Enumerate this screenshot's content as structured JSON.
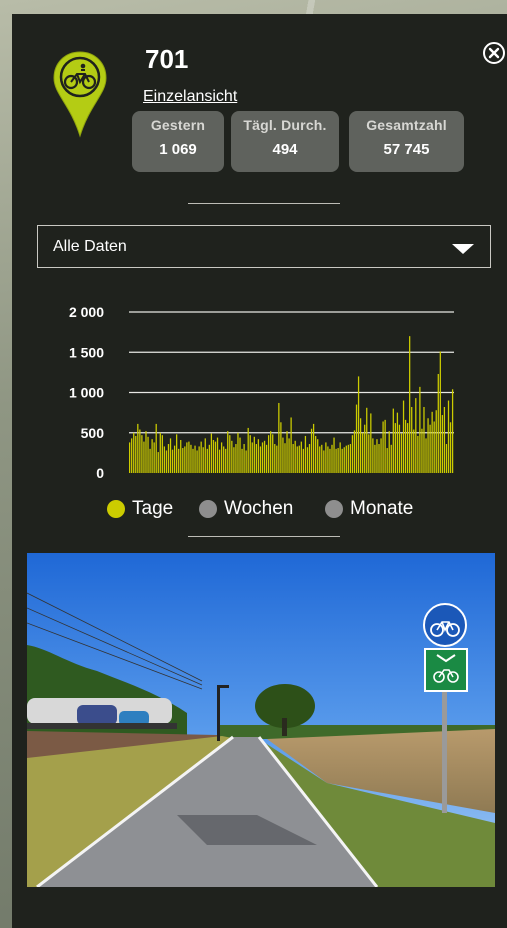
{
  "counter": {
    "id": "701",
    "detail_link": "Einzelansicht"
  },
  "stats": [
    {
      "label": "Gestern",
      "value": "1 069"
    },
    {
      "label": "Tägl. Durch.",
      "value": "494"
    },
    {
      "label": "Gesamtzahl",
      "value": "57 745"
    }
  ],
  "filter": {
    "selected": "Alle Daten"
  },
  "legend": [
    {
      "label": "Tage",
      "color": "#cccc00",
      "active": true
    },
    {
      "label": "Wochen",
      "color": "#8e8e8e",
      "active": false
    },
    {
      "label": "Monate",
      "color": "#8e8e8e",
      "active": false
    }
  ],
  "icons": {
    "pin": "bicycle-map-pin-icon",
    "close": "close-circle-icon",
    "dropdown": "caret-down-icon"
  },
  "colors": {
    "panel_bg": "#1f221d",
    "bar": "#cccc00",
    "pin": "#b4cc14",
    "stat_bg": "#5f625d"
  },
  "chart_data": {
    "type": "bar",
    "ylim": [
      0,
      2000
    ],
    "yticks": [
      0,
      500,
      1000,
      1500,
      2000
    ],
    "ytick_labels": [
      "0",
      "500",
      "1 000",
      "1 500",
      "2 000"
    ],
    "grid": true,
    "series": [
      {
        "values": [
          380,
          430,
          500,
          460,
          610,
          540,
          470,
          390,
          520,
          450,
          300,
          420,
          380,
          610,
          260,
          500,
          470,
          330,
          280,
          360,
          430,
          290,
          340,
          480,
          300,
          410,
          310,
          330,
          380,
          390,
          350,
          300,
          340,
          280,
          330,
          390,
          320,
          430,
          300,
          350,
          490,
          410,
          390,
          440,
          290,
          380,
          330,
          300,
          520,
          470,
          400,
          320,
          360,
          500,
          440,
          300,
          360,
          280,
          560,
          470,
          380,
          450,
          360,
          420,
          330,
          380,
          400,
          350,
          470,
          520,
          480,
          360,
          340,
          870,
          630,
          440,
          370,
          520,
          430,
          690,
          360,
          400,
          330,
          340,
          390,
          300,
          460,
          320,
          360,
          550,
          610,
          460,
          420,
          330,
          350,
          280,
          380,
          330,
          300,
          350,
          440,
          300,
          310,
          380,
          300,
          320,
          340,
          350,
          360,
          470,
          530,
          850,
          1200,
          680,
          500,
          600,
          810,
          480,
          740,
          430,
          350,
          420,
          360,
          430,
          640,
          660,
          310,
          520,
          350,
          800,
          620,
          750,
          600,
          490,
          900,
          660,
          620,
          1700,
          820,
          540,
          930,
          460,
          1070,
          550,
          820,
          430,
          680,
          600,
          760,
          640,
          780,
          1230,
          1510,
          720,
          820,
          360,
          900,
          630,
          1040
        ]
      }
    ]
  }
}
